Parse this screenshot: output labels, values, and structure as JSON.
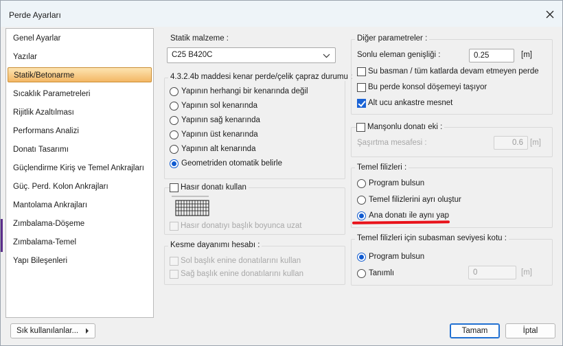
{
  "window": {
    "title": "Perde Ayarları"
  },
  "nav": {
    "items": [
      "Genel Ayarlar",
      "Yazılar",
      "Statik/Betonarme",
      "Sıcaklık Parametreleri",
      "Rijitlik Azaltılması",
      "Performans Analizi",
      "Donatı Tasarımı",
      "Güçlendirme Kiriş ve Temel Ankrajları",
      "Güç. Perd. Kolon Ankrajları",
      "Mantolama Ankrajları",
      "Zımbalama-Döşeme",
      "Zımbalama-Temel",
      "Yapı Bileşenleri"
    ],
    "selected": "Statik/Betonarme"
  },
  "statik_malzeme": {
    "label": "Statik malzeme :",
    "value": "C25 B420C"
  },
  "perde_durumu": {
    "label": "4.3.2.4b maddesi kenar perde/çelik çapraz durumu :",
    "options": [
      "Yapının herhangi bir kenarında değil",
      "Yapının sol kenarında",
      "Yapının sağ kenarında",
      "Yapının üst kenarında",
      "Yapının alt kenarında",
      "Geometriden otomatik belirle"
    ],
    "selected": "Geometriden otomatik belirle"
  },
  "hasir": {
    "label": "Hasır donatı kullan",
    "checked": false,
    "option": "Hasır donatıyı başlık boyunca uzat"
  },
  "kesme": {
    "label": "Kesme dayanımı hesabı :",
    "options": [
      "Sol başlık enine donatılarını kullan",
      "Sağ başlık enine donatılarını kullan"
    ]
  },
  "diger": {
    "label": "Diğer parametreler :",
    "sonlu_label": "Sonlu eleman genişliği :",
    "sonlu_value": "0.25",
    "sonlu_unit": "[m]",
    "checks": [
      {
        "label": "Su basman / tüm katlarda devam etmeyen perde",
        "checked": false
      },
      {
        "label": "Bu perde konsol döşemeyi taşıyor",
        "checked": false
      },
      {
        "label": "Alt ucu ankastre mesnet",
        "checked": true
      }
    ]
  },
  "manson": {
    "label": "Manşonlu donatı eki :",
    "checked": false,
    "sasirtma_label": "Şaşırtma mesafesi :",
    "sasirtma_value": "0.6",
    "unit": "[m]"
  },
  "temel_filizleri": {
    "label": "Temel filizleri :",
    "options": [
      "Program bulsun",
      "Temel filizlerini ayrı oluştur",
      "Ana donatı ile aynı yap"
    ],
    "selected": "Ana donatı ile aynı yap"
  },
  "subasman": {
    "label": "Temel filizleri için subasman seviyesi kotu :",
    "options": [
      "Program bulsun",
      "Tanımlı"
    ],
    "selected": "Program bulsun",
    "value": "0",
    "unit": "[m]"
  },
  "footer": {
    "frequent_label": "Sık kullanılanlar...",
    "ok_label": "Tamam",
    "cancel_label": "İptal"
  },
  "colors": {
    "accent": "#1a63d6",
    "selection": "#f3b765",
    "annotation": "#e8121a"
  }
}
